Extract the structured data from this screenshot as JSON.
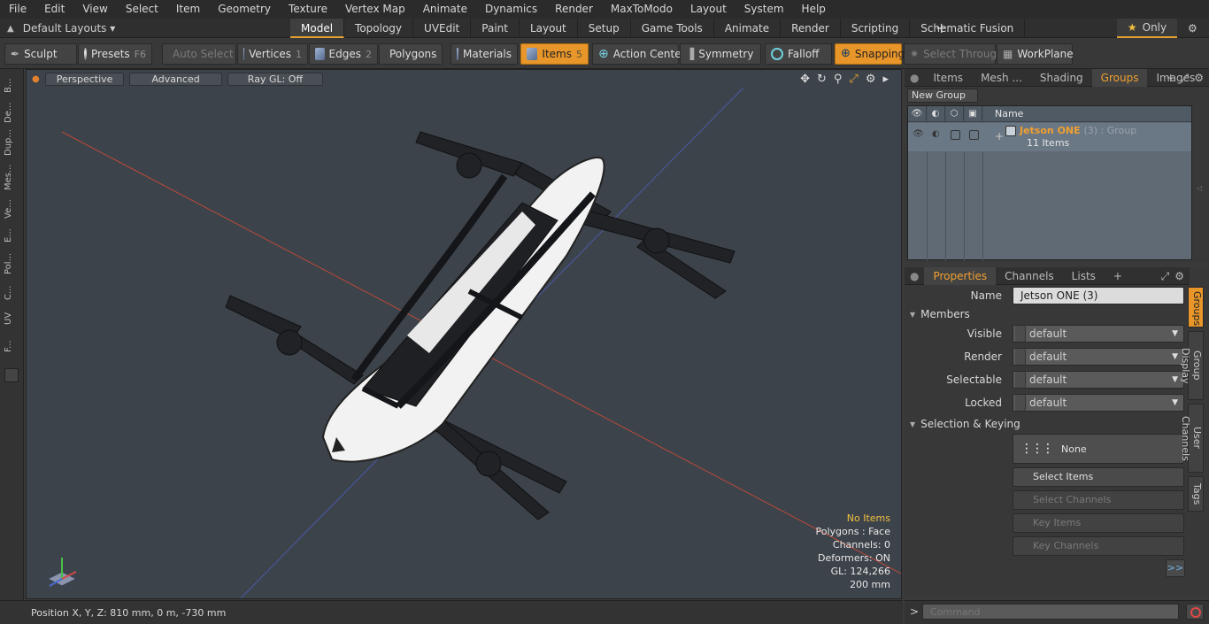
{
  "menubar": {
    "items": [
      "File",
      "Edit",
      "View",
      "Select",
      "Item",
      "Geometry",
      "Texture",
      "Vertex Map",
      "Animate",
      "Dynamics",
      "Render",
      "MaxToModo",
      "Layout",
      "System",
      "Help"
    ],
    "window_title": ""
  },
  "layoutbar": {
    "layout_label": "Default Layouts ▾",
    "tabs": [
      "Model",
      "Topology",
      "UVEdit",
      "Paint",
      "Layout",
      "Setup",
      "Game Tools",
      "Animate",
      "Render",
      "Scripting",
      "Schematic Fusion"
    ],
    "active_tab": "Model",
    "add": "+",
    "only_label": "Only"
  },
  "toolbar": {
    "sculpt": "Sculpt",
    "presets": "Presets",
    "presets_key": "F6",
    "auto_select": "Auto Select",
    "vertices": "Vertices",
    "vertices_count": "1",
    "edges": "Edges",
    "edges_count": "2",
    "polygons": "Polygons",
    "materials": "Materials",
    "items": "Items",
    "items_count": "5",
    "action_center": "Action Center",
    "symmetry": "Symmetry",
    "falloff": "Falloff",
    "snapping": "Snapping",
    "select_through": "Select Through",
    "workplane": "WorkPlane"
  },
  "leftstrip": {
    "tabs": [
      "B...",
      "De...",
      "Dup...",
      "Mes...",
      "Ve...",
      "E...",
      "Pol...",
      "C...",
      "UV",
      "F..."
    ]
  },
  "viewport": {
    "view_mode": "Perspective",
    "shading": "Advanced",
    "raygl": "Ray GL: Off",
    "info": {
      "no_items": "No Items",
      "polygons": "Polygons : Face",
      "channels": "Channels: 0",
      "deformers": "Deformers: ON",
      "gl": "GL: 124,266",
      "scale": "200 mm"
    }
  },
  "statusbar": {
    "position": "Position X, Y, Z:  810 mm, 0 m, -730 mm"
  },
  "groups_panel": {
    "tabs": [
      "Items",
      "Mesh ...",
      "Shading",
      "Groups",
      "Images"
    ],
    "active_tab": "Groups",
    "new_group": "New Group",
    "column_name": "Name",
    "group": {
      "name": "Jetson ONE",
      "count_type": "(3) : Group",
      "sub": "11 Items"
    }
  },
  "properties_panel": {
    "tabs": [
      "Properties",
      "Channels",
      "Lists"
    ],
    "active_tab": "Properties",
    "name_label": "Name",
    "name_value": "Jetson ONE (3)",
    "members_section": "Members",
    "visible_label": "Visible",
    "visible_value": "default",
    "render_label": "Render",
    "render_value": "default",
    "selectable_label": "Selectable",
    "selectable_value": "default",
    "locked_label": "Locked",
    "locked_value": "default",
    "selection_section": "Selection & Keying",
    "none_label": "None",
    "select_items": "Select Items",
    "select_channels": "Select Channels",
    "key_items": "Key Items",
    "key_channels": "Key Channels",
    "more": ">>",
    "vtabs": [
      "Groups",
      "Group Display",
      "User Channels",
      "Tags"
    ]
  },
  "command": {
    "placeholder": "Command",
    "arrow": ">"
  }
}
